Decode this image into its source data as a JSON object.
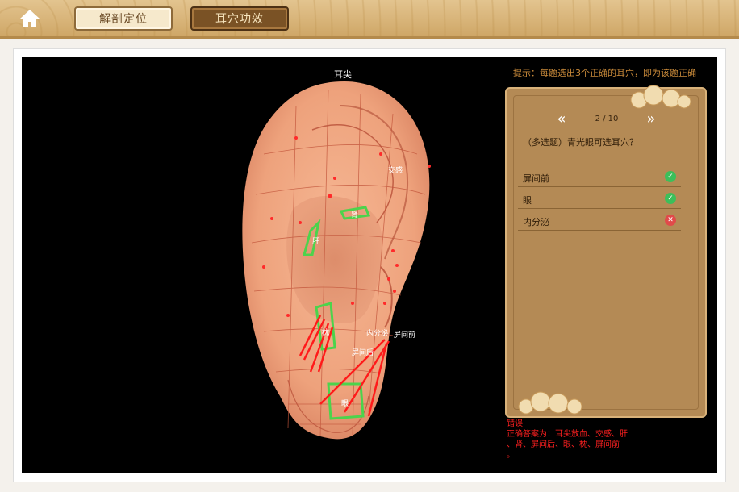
{
  "nav": {
    "tabs": [
      {
        "label": "解剖定位",
        "active": false
      },
      {
        "label": "耳穴功效",
        "active": true
      }
    ]
  },
  "hint": "提示：每题选出3个正确的耳穴，即为该题正确",
  "ear": {
    "top_label": "耳尖",
    "labels": {
      "jiaogan": "交感",
      "gan": "肝",
      "shen": "肾",
      "zhen": "枕",
      "neifenmi": "内分泌",
      "pingjianqian": "屏间前",
      "pingjianhou": "屏间后",
      "yan": "眼"
    }
  },
  "question": {
    "page": "2 / 10",
    "text": "（多选题）青光眼可选耳穴？",
    "options": [
      {
        "label": "屏间前",
        "status": "correct",
        "icon": "check-icon"
      },
      {
        "label": "眼",
        "status": "correct",
        "icon": "check-icon"
      },
      {
        "label": "内分泌",
        "status": "wrong",
        "icon": "cross-icon"
      }
    ]
  },
  "result": {
    "status": "错误",
    "line1": "正确答案为：耳尖放血、交感、肝",
    "line2": "、肾、屏间后、眼、枕、屏间前",
    "line3": "。"
  },
  "colors": {
    "accent": "#b48a55",
    "correct": "#3cbf5a",
    "wrong": "#e14a4a",
    "error_text": "#ff2020"
  }
}
